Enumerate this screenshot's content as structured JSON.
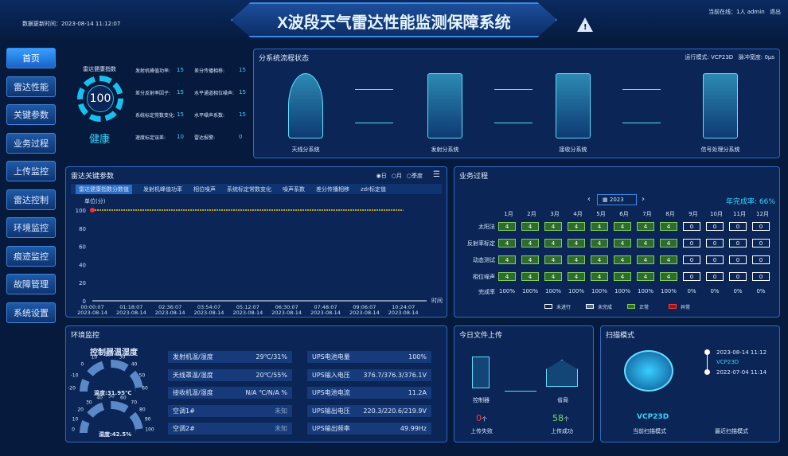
{
  "header": {
    "update_label": "数据更新时间：",
    "update_time": "2023-08-14 11:12:07",
    "title": "X波段天气雷达性能监测保障系统",
    "online": "当前在线：1人",
    "user": "admin",
    "logout": "退出"
  },
  "sidebar": [
    "首页",
    "雷达性能",
    "关键参数",
    "业务过程",
    "上传监控",
    "雷达控制",
    "环境监控",
    "痕迹监控",
    "故障管理",
    "系统设置"
  ],
  "health": {
    "title": "雷达健康指数",
    "score": "100",
    "status": "健康",
    "metrics": [
      [
        "发射机峰值功率:",
        "15",
        "差分传播相移:",
        "15"
      ],
      [
        "差分反射率因子:",
        "15",
        "水平通道相位噪声:",
        "15"
      ],
      [
        "系统标定常数变化:",
        "15",
        "水平噪声系数:",
        "15"
      ],
      [
        "速度标定误差:",
        "10",
        "雷达报警:",
        "0"
      ]
    ]
  },
  "subsystem": {
    "title": "分系统流程状态",
    "mode": "运行模式: VCP23D",
    "pulse": "脉冲宽度: 0μs",
    "items": [
      "天线分系统",
      "发射分系统",
      "接收分系统",
      "信号处理分系统"
    ]
  },
  "keyparams": {
    "title": "雷达关键参数",
    "radios": [
      "日",
      "月",
      "季度"
    ],
    "tabs": [
      "雷达健康指数分数值",
      "发射机峰值功率",
      "相位噪声",
      "系统标定常数变化",
      "噪声系数",
      "差分传播相移",
      "zdr标定值"
    ],
    "ylabel": "单位(分)",
    "xlabel": "时间",
    "yticks": [
      "100",
      "80",
      "60",
      "40",
      "20",
      "0"
    ],
    "xticks": [
      [
        "00:00:07",
        "2023-08-14"
      ],
      [
        "01:18:07",
        "2023-08-14"
      ],
      [
        "02:36:07",
        "2023-08-14"
      ],
      [
        "03:54:07",
        "2023-08-14"
      ],
      [
        "05:12:07",
        "2023-08-14"
      ],
      [
        "06:30:07",
        "2023-08-14"
      ],
      [
        "07:48:07",
        "2023-08-14"
      ],
      [
        "09:06:07",
        "2023-08-14"
      ],
      [
        "10:24:07",
        "2023-08-14"
      ]
    ]
  },
  "chart_data": {
    "type": "line",
    "x": [
      "00:00:07",
      "01:18:07",
      "02:36:07",
      "03:54:07",
      "05:12:07",
      "06:30:07",
      "07:48:07",
      "09:06:07",
      "10:24:07"
    ],
    "values": [
      100,
      100,
      100,
      100,
      100,
      100,
      100,
      100,
      100
    ],
    "ylim": [
      0,
      100
    ],
    "ylabel": "单位(分)",
    "xlabel": "时间"
  },
  "business": {
    "title": "业务过程",
    "year": "2023",
    "completion": "年完成率: 66%",
    "months": [
      "1月",
      "2月",
      "3月",
      "4月",
      "5月",
      "6月",
      "7月",
      "8月",
      "9月",
      "10月",
      "11月",
      "12月"
    ],
    "rows": [
      {
        "name": "太阳法",
        "values": [
          "4",
          "4",
          "4",
          "4",
          "4",
          "4",
          "4",
          "4",
          "0",
          "0",
          "0",
          "0"
        ]
      },
      {
        "name": "反射率标定",
        "values": [
          "4",
          "4",
          "4",
          "4",
          "4",
          "4",
          "4",
          "4",
          "0",
          "0",
          "0",
          "0"
        ]
      },
      {
        "name": "动态测试",
        "values": [
          "4",
          "4",
          "4",
          "4",
          "4",
          "4",
          "4",
          "4",
          "0",
          "0",
          "0",
          "0"
        ]
      },
      {
        "name": "相位噪声",
        "values": [
          "4",
          "4",
          "4",
          "4",
          "4",
          "4",
          "4",
          "4",
          "0",
          "0",
          "0",
          "0"
        ]
      }
    ],
    "rate_label": "完成率",
    "rates": [
      "100%",
      "100%",
      "100%",
      "100%",
      "100%",
      "100%",
      "100%",
      "100%",
      "0%",
      "0%",
      "0%",
      "0%"
    ],
    "legend": [
      "未进行",
      "未完成",
      "正常",
      "异常"
    ]
  },
  "env": {
    "title": "环境监控",
    "gauge_title": "控制器温湿度",
    "temp": "温度:31.95℃",
    "hum": "湿度:42.5%",
    "gauge_ticks1": [
      "-20",
      "-10",
      "0",
      "10",
      "20",
      "30",
      "40",
      "50",
      "60"
    ],
    "gauge_ticks2": [
      "0",
      "10",
      "20",
      "30",
      "40",
      "50",
      "60",
      "70",
      "80",
      "90",
      "100"
    ],
    "left": [
      [
        "发射机温/湿度",
        "29℃/31%"
      ],
      [
        "天线罩温/湿度",
        "20℃/55%"
      ],
      [
        "接收机温/湿度",
        "N/A ℃/N/A %"
      ],
      [
        "空调1#",
        "未知"
      ],
      [
        "空调2#",
        "未知"
      ]
    ],
    "right": [
      [
        "UPS电池电量",
        "100%"
      ],
      [
        "UPS输入电压",
        "376.7/376.3/376.1V"
      ],
      [
        "UPS电池电流",
        "11.2A"
      ],
      [
        "UPS输出电压",
        "220.3/220.6/219.9V"
      ],
      [
        "UPS输出频率",
        "49.99Hz"
      ]
    ]
  },
  "upload": {
    "title": "今日文件上传",
    "from": "控制器",
    "to": "省局",
    "fail_num": "0",
    "fail_unit": "个",
    "fail_label": "上传失败",
    "ok_num": "58",
    "ok_unit": "个",
    "ok_label": "上传成功"
  },
  "scan": {
    "title": "扫描模式",
    "t1": "2023-08-14 11:12",
    "mode": "VCP23D",
    "t2": "2022-07-04 11:14",
    "current": "VCP23D",
    "current_label": "当前扫描模式",
    "recent_label": "最近扫描模式"
  }
}
